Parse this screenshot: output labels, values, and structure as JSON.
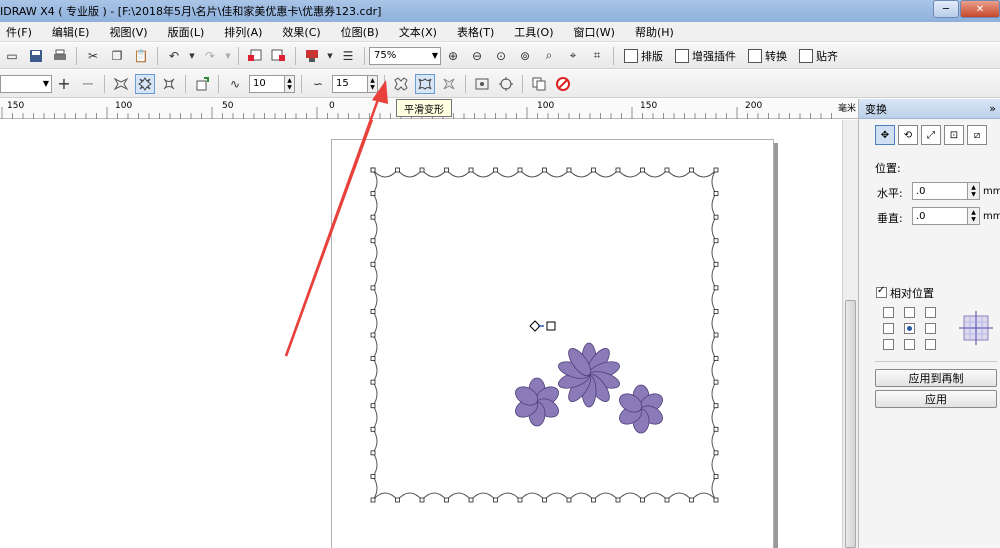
{
  "window": {
    "title": "IDRAW X4 ( 专业版 ) - [F:\\2018年5月\\名片\\佳和家美优惠卡\\优惠券123.cdr]",
    "minimize": "─",
    "close": "✕"
  },
  "menu": [
    {
      "label": "件(F)"
    },
    {
      "label": "编辑(E)"
    },
    {
      "label": "视图(V)"
    },
    {
      "label": "版面(L)"
    },
    {
      "label": "排列(A)"
    },
    {
      "label": "效果(C)"
    },
    {
      "label": "位图(B)"
    },
    {
      "label": "文本(X)"
    },
    {
      "label": "表格(T)"
    },
    {
      "label": "工具(O)"
    },
    {
      "label": "窗口(W)"
    },
    {
      "label": "帮助(H)"
    }
  ],
  "toolbar": {
    "zoom_value": "75%",
    "imposition_label": "排版",
    "enhanced_plugin_label": "增强插件",
    "convert_label": "转换",
    "snap_label": "贴齐"
  },
  "propbar": {
    "nodes_value": "10",
    "smooth_value": "15",
    "tooltip": "平滑变形"
  },
  "ruler": {
    "unit": "毫米",
    "labels": [
      "150",
      "100",
      "50",
      "0",
      "50",
      "100",
      "150",
      "200"
    ]
  },
  "docker": {
    "title": "变换",
    "collapse": "»",
    "position_label": "位置:",
    "horizontal_label": "水平:",
    "vertical_label": "垂直:",
    "horizontal_value": ".0",
    "vertical_value": ".0",
    "unit": "mm",
    "relative_label": "相对位置",
    "relative_checked": true,
    "apply_copy_label": "应用到再制",
    "apply_label": "应用"
  },
  "colors": {
    "flower_fill": "#8b7ab8",
    "flower_stroke": "#4d3f78",
    "annotation_arrow": "#e8413b"
  }
}
